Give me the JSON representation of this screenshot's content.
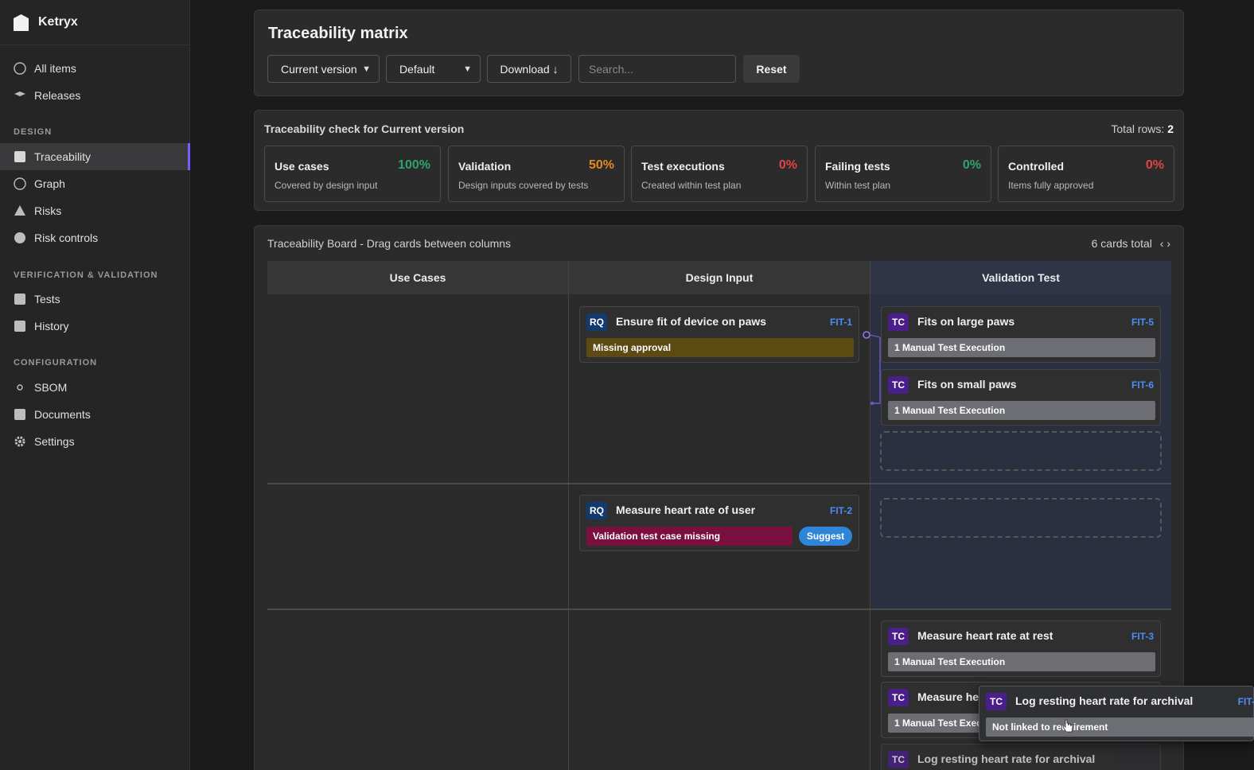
{
  "brand": {
    "name": "Ketryx"
  },
  "sidebar": {
    "items_top": [
      {
        "label": "All items",
        "icon": "circle-icon"
      },
      {
        "label": "Releases",
        "icon": "layers-icon"
      }
    ],
    "sections": [
      {
        "label": "DESIGN",
        "items": [
          {
            "label": "Traceability",
            "icon": "square-icon",
            "active": true
          },
          {
            "label": "Graph",
            "icon": "circle-icon"
          },
          {
            "label": "Risks",
            "icon": "triangle-icon"
          },
          {
            "label": "Risk controls",
            "icon": "filled-circle-icon"
          }
        ]
      },
      {
        "label": "VERIFICATION & VALIDATION",
        "items": [
          {
            "label": "Tests",
            "icon": "square-icon"
          },
          {
            "label": "History",
            "icon": "square-icon"
          }
        ]
      },
      {
        "label": "CONFIGURATION",
        "items": [
          {
            "label": "SBOM",
            "icon": "dot-icon"
          },
          {
            "label": "Documents",
            "icon": "square-icon"
          },
          {
            "label": "Settings",
            "icon": "gear-icon"
          }
        ]
      }
    ]
  },
  "header": {
    "title": "Traceability matrix",
    "version_select": "Current version",
    "view_select": "Default",
    "download_label": "Download ↓",
    "search_placeholder": "Search...",
    "reset_label": "Reset"
  },
  "check": {
    "title": "Traceability check for Current version",
    "total_rows_label": "Total rows:",
    "total_rows_value": "2",
    "metrics": [
      {
        "name": "Use cases",
        "pct": "100%",
        "desc": "Covered by design input",
        "color": "#2ea36b"
      },
      {
        "name": "Validation",
        "pct": "50%",
        "desc": "Design inputs covered by tests",
        "color": "#e08a1e"
      },
      {
        "name": "Test executions",
        "pct": "0%",
        "desc": "Created within test plan",
        "color": "#e04545"
      },
      {
        "name": "Failing tests",
        "pct": "0%",
        "desc": "Within test plan",
        "color": "#2ea36b"
      },
      {
        "name": "Controlled",
        "pct": "0%",
        "desc": "Items fully approved",
        "color": "#e04545"
      }
    ]
  },
  "board": {
    "title": "Traceability Board - Drag cards between columns",
    "count": "6 cards total",
    "nav": "‹ ›",
    "columns": [
      "Use Cases",
      "Design Input",
      "Validation Test"
    ],
    "cards": [
      {
        "type": "RQ",
        "title": "Ensure fit of device on paws",
        "id": "FIT-1",
        "bar": "Missing approval"
      },
      {
        "type": "TC",
        "title": "Fits on large paws",
        "id": "FIT-5",
        "bar": "1 Manual Test Execution"
      },
      {
        "type": "TC",
        "title": "Fits on small paws",
        "id": "FIT-6",
        "bar": "1 Manual Test Execution"
      },
      {
        "type": "RQ",
        "title": "Measure heart rate of user",
        "id": "FIT-2",
        "bar": "Validation test case missing",
        "action": "Suggest"
      },
      {
        "type": "TC",
        "title": "Measure heart rate at rest",
        "id": "FIT-3",
        "bar": "1 Manual Test Execution"
      },
      {
        "type": "TC",
        "title": "Measure hea",
        "id": "",
        "bar": "1 Manual Test Exec"
      },
      {
        "type": "TC",
        "title": "Log resting heart rate for archival",
        "id": "FIT-",
        "bar": "Not linked to requirement"
      },
      {
        "type": "TC",
        "title": "Log resting heart rate for archival",
        "id": "",
        "bar": ""
      }
    ]
  }
}
